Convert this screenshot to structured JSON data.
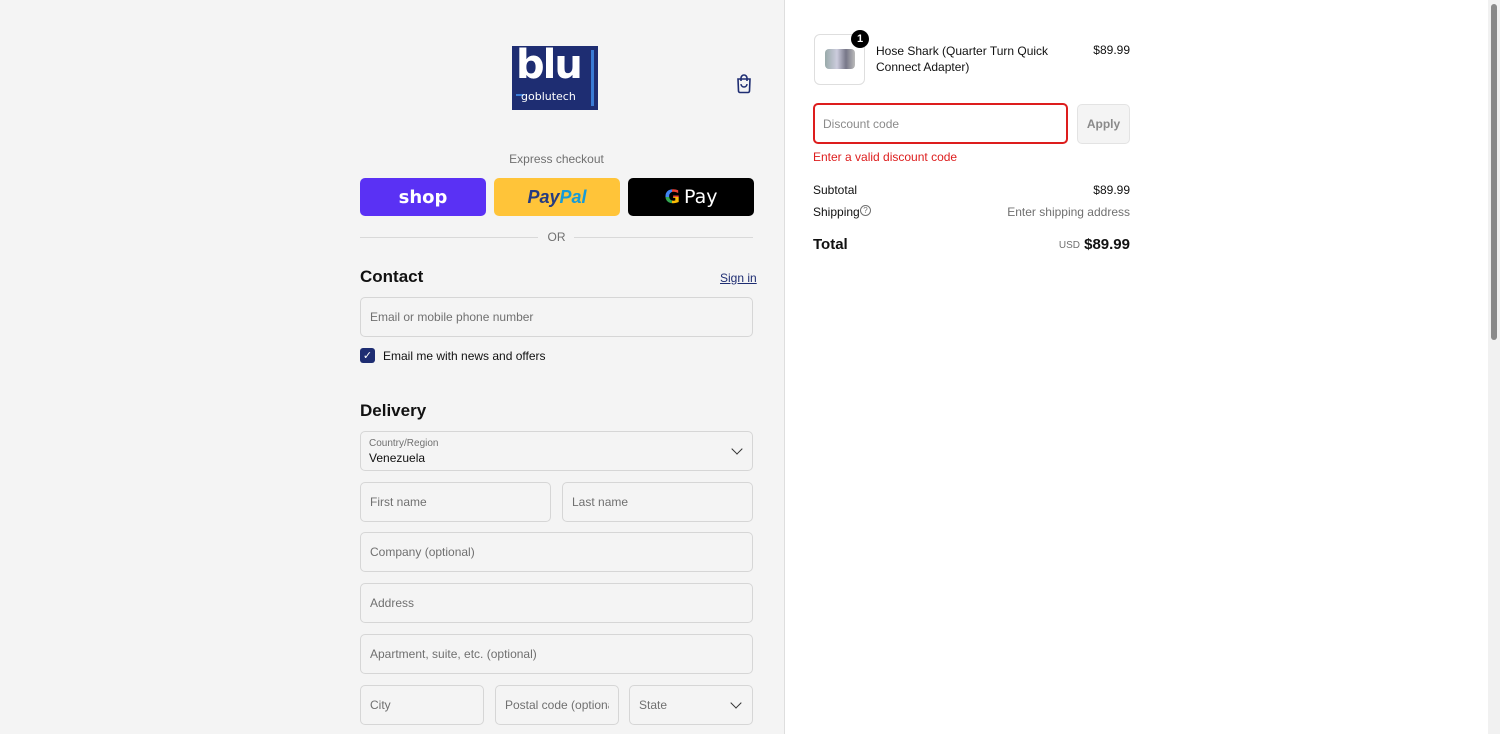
{
  "brand": {
    "logo_text": "blu",
    "logo_subtext": "goblutech"
  },
  "express": {
    "label": "Express checkout",
    "shop_label": "shop",
    "paypal_label_a": "Pay",
    "paypal_label_b": "Pal",
    "gpay_label": "Pay",
    "or_label": "OR"
  },
  "contact": {
    "heading": "Contact",
    "signin_label": "Sign in",
    "email_placeholder": "Email or mobile phone number",
    "newsletter_label": "Email me with news and offers",
    "newsletter_checked": true
  },
  "delivery": {
    "heading": "Delivery",
    "country_label": "Country/Region",
    "country_value": "Venezuela",
    "first_name_placeholder": "First name",
    "last_name_placeholder": "Last name",
    "company_placeholder": "Company (optional)",
    "address_placeholder": "Address",
    "apartment_placeholder": "Apartment, suite, etc. (optional)",
    "city_placeholder": "City",
    "postal_placeholder": "Postal code (optional)",
    "state_placeholder": "State"
  },
  "summary": {
    "item": {
      "name": "Hose Shark (Quarter Turn Quick Connect Adapter)",
      "price": "$89.99",
      "quantity": "1"
    },
    "discount_placeholder": "Discount code",
    "apply_label": "Apply",
    "discount_error": "Enter a valid discount code",
    "subtotal_label": "Subtotal",
    "subtotal_value": "$89.99",
    "shipping_label": "Shipping",
    "shipping_value": "Enter shipping address",
    "total_label": "Total",
    "total_currency": "USD",
    "total_value": "$89.99"
  },
  "colors": {
    "brand": "#1e2d72",
    "shop": "#5a31f4",
    "paypal": "#ffc439",
    "error": "#dd1d1d"
  }
}
